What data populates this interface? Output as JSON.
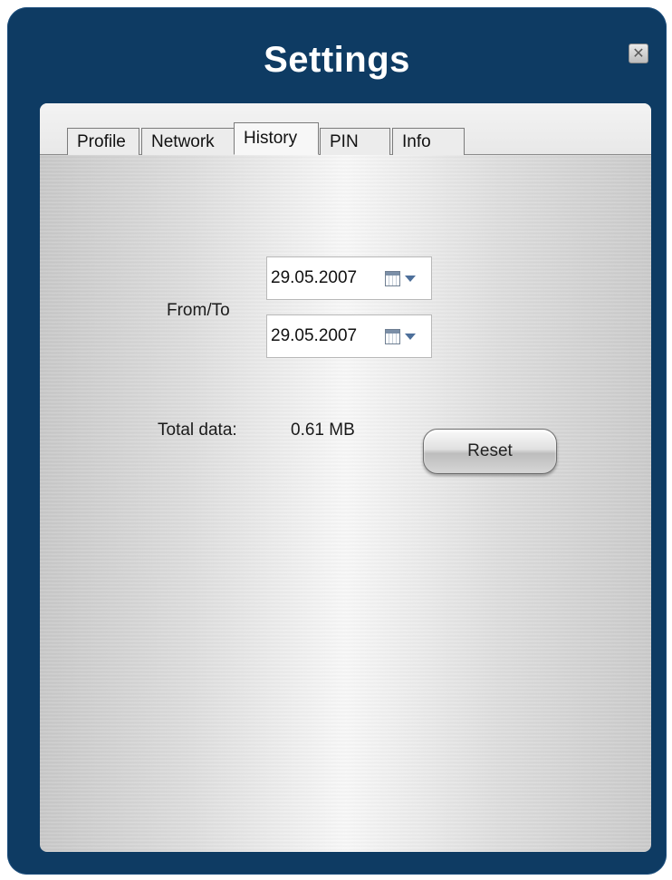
{
  "window": {
    "title": "Settings",
    "close_icon": "close-icon"
  },
  "tabs": [
    {
      "label": "Profile"
    },
    {
      "label": "Network"
    },
    {
      "label": "History",
      "active": true
    },
    {
      "label": "PIN"
    },
    {
      "label": "Info"
    }
  ],
  "history": {
    "from_to_label": "From/To",
    "from_date": "29.05.2007",
    "to_date": "29.05.2007",
    "calendar_icon": "calendar-icon",
    "dropdown_icon": "chevron-down-icon",
    "total_data_label": "Total data:",
    "total_data_value": "0.61 MB",
    "reset_label": "Reset"
  },
  "colors": {
    "frame": "#0e3b63",
    "title_text": "#ffffff",
    "panel": "#dedede"
  }
}
